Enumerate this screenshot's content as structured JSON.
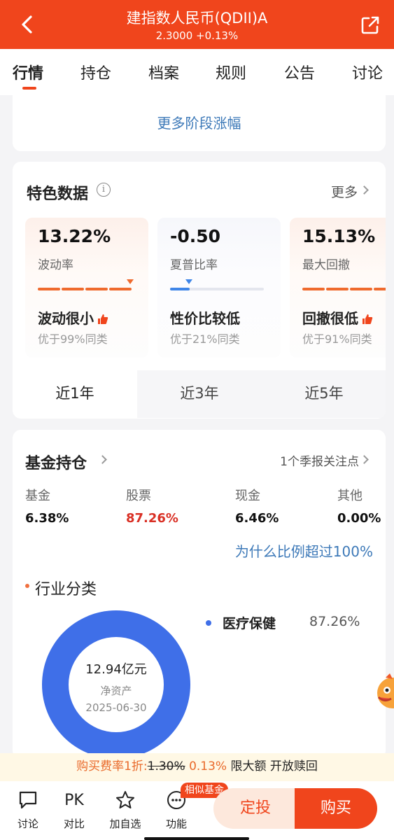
{
  "header": {
    "title": "建指数人民币(QDII)A",
    "subtitle": "2.3000 +0.13%"
  },
  "tabs": [
    {
      "label": "行情"
    },
    {
      "label": "持仓"
    },
    {
      "label": "档案"
    },
    {
      "label": "规则"
    },
    {
      "label": "公告"
    },
    {
      "label": "讨论"
    }
  ],
  "stage_gains": {
    "more_label": "更多阶段涨幅"
  },
  "featured": {
    "title": "特色数据",
    "info_glyph": "i",
    "more_label": "更多",
    "metrics": [
      {
        "value": "13.22%",
        "label": "波动率",
        "eval": "波动很小",
        "rank": "优于99%同类",
        "thumb": true
      },
      {
        "value": "-0.50",
        "label": "夏普比率",
        "eval": "性价比较低",
        "rank": "优于21%同类",
        "thumb": false
      },
      {
        "value": "15.13%",
        "label": "最大回撤",
        "eval": "回撤很低",
        "rank": "优于91%同类",
        "thumb": true
      }
    ],
    "periods": [
      {
        "label": "近1年",
        "selected": true
      },
      {
        "label": "近3年",
        "selected": false
      },
      {
        "label": "近5年",
        "selected": false
      }
    ]
  },
  "holdings": {
    "title": "基金持仓",
    "notice": "1个季报关注点",
    "allocation": [
      {
        "label": "基金",
        "value": "6.38%"
      },
      {
        "label": "股票",
        "value": "87.26%"
      },
      {
        "label": "现金",
        "value": "6.46%"
      },
      {
        "label": "其他",
        "value": "0.00%"
      }
    ],
    "why_link": "为什么比例超过100%",
    "industry_title": "行业分类",
    "donut": {
      "amount": "12.94亿元",
      "caption": "净资产",
      "date": "2025-06-30"
    },
    "legend": [
      {
        "name": "医疗保健",
        "value": "87.26%",
        "color": "#3f6fe8"
      }
    ]
  },
  "promo": {
    "prefix": "购买费率1折:",
    "original": "1.30%",
    "discounted": "0.13%",
    "suffix": "限大额 开放赎回"
  },
  "bottom_bar": {
    "discuss": {
      "icon": "chat-bubble-icon",
      "label": "讨论"
    },
    "compare": {
      "icon_text": "PK",
      "label": "对比"
    },
    "watchlist": {
      "icon": "star-icon",
      "label": "加自选"
    },
    "features": {
      "icon": "dots-icon",
      "label": "功能"
    },
    "similar_tag": "相似基金",
    "auto_invest": "定投",
    "buy": "购买"
  },
  "colors": {
    "brand": "#f0451c",
    "link": "#3d79b8",
    "donut": "#3f6fe8",
    "negative": "#d93025"
  }
}
